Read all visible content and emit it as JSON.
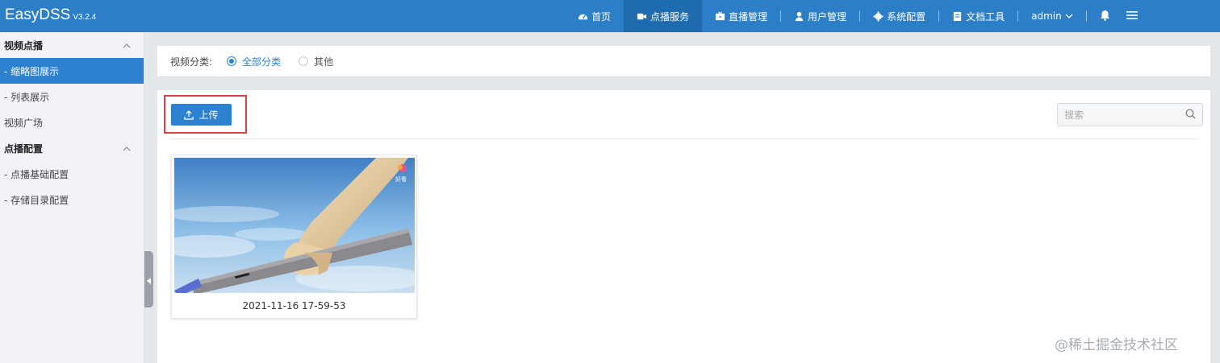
{
  "app": {
    "name": "EasyDSS",
    "version": "V3.2.4"
  },
  "nav": {
    "items": [
      {
        "label": "首页",
        "icon": "dashboard-icon"
      },
      {
        "label": "点播服务",
        "icon": "video-camera-icon",
        "active": true
      },
      {
        "label": "直播管理",
        "icon": "live-icon"
      },
      {
        "label": "用户管理",
        "icon": "user-icon"
      },
      {
        "label": "系统配置",
        "icon": "gear-icon"
      },
      {
        "label": "文档工具",
        "icon": "document-icon"
      }
    ],
    "user": "admin"
  },
  "sidebar": {
    "groups": [
      {
        "title": "视频点播",
        "items": [
          "- 缩略图展示",
          "- 列表展示",
          "视频广场"
        ]
      },
      {
        "title": "点播配置",
        "items": [
          "- 点播基础配置",
          "- 存储目录配置"
        ]
      }
    ],
    "active_item": "- 缩略图展示"
  },
  "filter": {
    "label": "视频分类:",
    "options": [
      {
        "label": "全部分类",
        "checked": true
      },
      {
        "label": "其他",
        "checked": false
      }
    ]
  },
  "toolbar": {
    "upload_label": "上传",
    "search_placeholder": "搜索"
  },
  "videos": [
    {
      "title": "2021-11-16 17-59-53",
      "badge": "好看"
    }
  ],
  "watermark": "@稀土掘金技术社区",
  "colors": {
    "primary": "#2c82d0",
    "topbar": "#2c7fc7",
    "highlight": "#e03c3c"
  }
}
